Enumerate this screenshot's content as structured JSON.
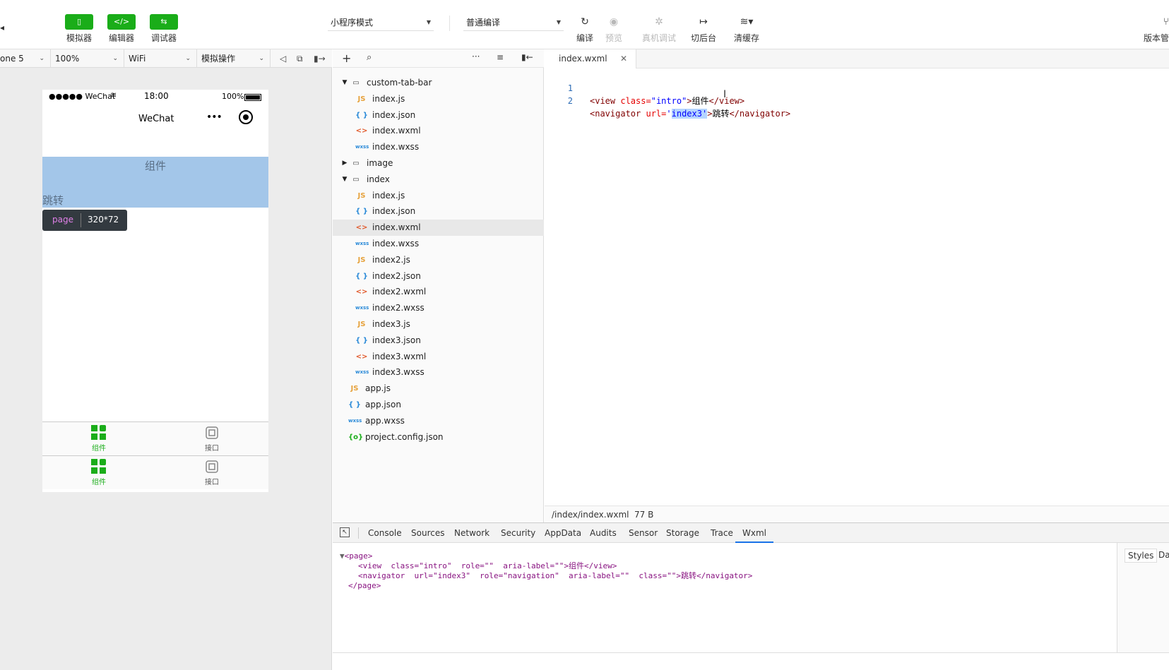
{
  "toolbar": {
    "simulator_label": "模拟器",
    "editor_label": "编辑器",
    "debugger_label": "调试器",
    "mode_select": "小程序模式",
    "compile_select": "普通编译",
    "compile_label": "编译",
    "preview_label": "预览",
    "remote_debug_label": "真机调试",
    "background_label": "切后台",
    "clear_cache_label": "清缓存",
    "version_label": "版本管"
  },
  "sim_toolbar": {
    "device": "one 5",
    "zoom": "100%",
    "network": "WiFi",
    "operation": "模拟操作"
  },
  "phone": {
    "carrier": "●●●●● WeChat",
    "time": "18:00",
    "battery": "100%",
    "nav_title": "WeChat",
    "intro_text": "组件",
    "nav_link_text": "跳转",
    "tooltip_tag": "page",
    "tooltip_size": "320*72",
    "tabbar_rows": [
      {
        "left_label": "组件",
        "right_label": "接口"
      },
      {
        "left_label": "组件",
        "right_label": "接口"
      }
    ]
  },
  "tree": {
    "nodes": [
      {
        "name": "custom-tab-bar",
        "type": "folder-open"
      },
      {
        "name": "index.js",
        "type": "js"
      },
      {
        "name": "index.json",
        "type": "json"
      },
      {
        "name": "index.wxml",
        "type": "wxml"
      },
      {
        "name": "index.wxss",
        "type": "wxss"
      },
      {
        "name": "image",
        "type": "folder-closed"
      },
      {
        "name": "index",
        "type": "folder-open"
      },
      {
        "name": "index.js",
        "type": "js"
      },
      {
        "name": "index.json",
        "type": "json"
      },
      {
        "name": "index.wxml",
        "type": "wxml",
        "selected": true
      },
      {
        "name": "index.wxss",
        "type": "wxss"
      },
      {
        "name": "index2.js",
        "type": "js"
      },
      {
        "name": "index2.json",
        "type": "json"
      },
      {
        "name": "index2.wxml",
        "type": "wxml"
      },
      {
        "name": "index2.wxss",
        "type": "wxss"
      },
      {
        "name": "index3.js",
        "type": "js"
      },
      {
        "name": "index3.json",
        "type": "json"
      },
      {
        "name": "index3.wxml",
        "type": "wxml"
      },
      {
        "name": "index3.wxss",
        "type": "wxss"
      },
      {
        "name": "app.js",
        "type": "js"
      },
      {
        "name": "app.json",
        "type": "json"
      },
      {
        "name": "app.wxss",
        "type": "wxss"
      },
      {
        "name": "project.config.json",
        "type": "config"
      }
    ]
  },
  "editor": {
    "tab_name": "index.wxml",
    "line1_no": "1",
    "line2_no": "2",
    "line1": {
      "open": "<view ",
      "attr": "class=",
      "val": "\"intro\"",
      "close": ">",
      "text": "组件",
      "end": "</view>"
    },
    "line2": {
      "open": "<navigator ",
      "attr": "url=",
      "q": "'",
      "val": "index3'",
      "close": ">",
      "text": "跳转",
      "end": "</navigator>"
    },
    "status_path": "/index/index.wxml",
    "status_size": "77 B"
  },
  "devtools": {
    "tabs": [
      "Console",
      "Sources",
      "Network",
      "Security",
      "AppData",
      "Audits",
      "Sensor",
      "Storage",
      "Trace",
      "Wxml"
    ],
    "active_tab": "Wxml",
    "styles_tab": "Styles",
    "data_tab": "Dat",
    "wxml": {
      "page_open": "<page>",
      "view_line": "<view  class=\"intro\"  role=\"\"  aria-label=\"\">组件</view>",
      "nav_line": "<navigator  url=\"index3\"  role=\"navigation\"  aria-label=\"\"  class=\"\">跳转</navigator>",
      "page_close": "</page>"
    }
  },
  "colors": {
    "accent_green": "#1aad19",
    "intro_bg": "#a3c6e9",
    "selection": "#b5d5ff"
  }
}
